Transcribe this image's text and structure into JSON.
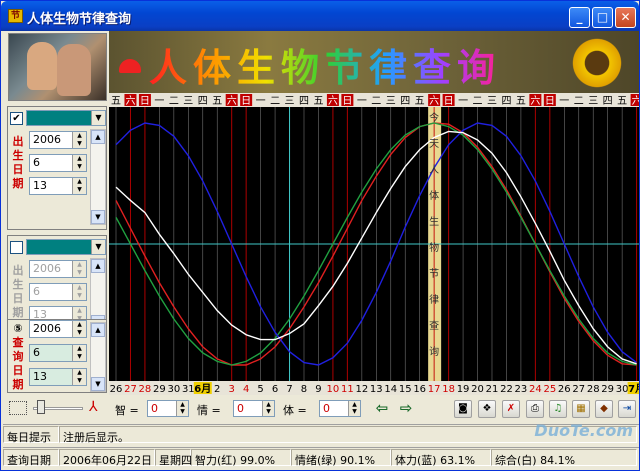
{
  "window": {
    "title": "人体生物节律查询",
    "app_icon": "节"
  },
  "banner": {
    "title": "人体生物节律查询"
  },
  "weekday_header": [
    "五",
    "六",
    "日",
    "一",
    "二",
    "三",
    "四",
    "五",
    "六",
    "日",
    "一",
    "二",
    "三",
    "四",
    "五",
    "六",
    "日",
    "一",
    "二",
    "三",
    "四",
    "五",
    "六",
    "日",
    "一",
    "二",
    "三",
    "四",
    "五",
    "六",
    "日",
    "一",
    "二",
    "三",
    "四",
    "五",
    "六",
    "日"
  ],
  "date_footer": [
    "26",
    "27",
    "28",
    "29",
    "30",
    "31",
    "6月",
    "2",
    "3",
    "4",
    "5",
    "6",
    "7",
    "8",
    "9",
    "10",
    "11",
    "12",
    "13",
    "14",
    "15",
    "16",
    "17",
    "18",
    "19",
    "20",
    "21",
    "22",
    "23",
    "24",
    "25",
    "26",
    "27",
    "28",
    "29",
    "30",
    "7月"
  ],
  "highlight_text": "今天人体生物节律查询",
  "person1": {
    "checked": true,
    "check_mark": "✔",
    "label": "出生日期",
    "year": "2006",
    "month": "6",
    "day": "13",
    "color": "#008080"
  },
  "person2": {
    "checked": false,
    "check_mark": "",
    "label": "出生日期",
    "year": "2006",
    "month": "6",
    "day": "13",
    "color": "#008080"
  },
  "query": {
    "label": "查询日期",
    "year": "2006",
    "month": "6",
    "day": "13"
  },
  "toolbar": {
    "zhi_label": "智 =",
    "zhi_value": "0",
    "qing_label": "情 =",
    "qing_value": "0",
    "ti_label": "体 =",
    "ti_value": "0",
    "left_arrow": "⇦",
    "right_arrow": "⇨"
  },
  "status": {
    "tip_label": "每日提示",
    "tip_text": "注册后显示。",
    "query_label": "查询日期",
    "query_date": "2006年06月22日",
    "weekday": "星期四",
    "zhili": "智力(红) 99.0%",
    "qingxu": "情绪(绿) 90.1%",
    "tili": "体力(蓝) 63.1%",
    "zonghe": "综合(白) 84.1%"
  },
  "watermark": "DuoTe.com",
  "colors": {
    "intellect": "#e02020",
    "emotion": "#20a040",
    "physical": "#2020e0",
    "overall": "#ffffff",
    "grid_red": "#c00000",
    "grid_white": "#d0d0d0",
    "highlight": "#e8d890"
  },
  "chart_data": {
    "type": "line",
    "title": "",
    "series": [
      {
        "name": "智力(红)",
        "values": [
          0.36,
          0.13,
          -0.1,
          -0.32,
          -0.52,
          -0.7,
          -0.85,
          -0.95,
          -1.0,
          -1.0,
          -0.95,
          -0.85,
          -0.7,
          -0.52,
          -0.32,
          -0.1,
          0.13,
          0.36,
          0.56,
          0.74,
          0.88,
          0.97,
          1.0,
          0.99,
          0.92,
          0.8,
          0.64,
          0.45,
          0.23,
          0.0,
          -0.23,
          -0.45,
          -0.64,
          -0.8,
          -0.92,
          -0.99,
          -1.0
        ]
      },
      {
        "name": "情绪(绿)",
        "values": [
          0.22,
          0.0,
          -0.22,
          -0.43,
          -0.62,
          -0.78,
          -0.9,
          -0.97,
          -1.0,
          -0.97,
          -0.9,
          -0.78,
          -0.62,
          -0.43,
          -0.22,
          0.0,
          0.22,
          0.43,
          0.62,
          0.78,
          0.9,
          0.97,
          1.0,
          0.97,
          0.9,
          0.78,
          0.62,
          0.43,
          0.22,
          0.0,
          -0.22,
          -0.43,
          -0.62,
          -0.78,
          -0.9,
          -0.97,
          -1.0
        ]
      },
      {
        "name": "体力(蓝)",
        "values": [
          0.82,
          0.94,
          1.0,
          0.98,
          0.89,
          0.73,
          0.52,
          0.27,
          0.0,
          -0.27,
          -0.52,
          -0.73,
          -0.89,
          -0.98,
          -1.0,
          -0.94,
          -0.82,
          -0.63,
          -0.4,
          -0.14,
          0.14,
          0.4,
          0.63,
          0.82,
          0.94,
          1.0,
          0.98,
          0.89,
          0.73,
          0.52,
          0.27,
          0.0,
          -0.27,
          -0.52,
          -0.73,
          -0.89,
          -0.98
        ]
      },
      {
        "name": "综合(白)",
        "values": [
          0.47,
          0.36,
          0.26,
          0.08,
          -0.08,
          -0.25,
          -0.4,
          -0.55,
          -0.67,
          -0.75,
          -0.79,
          -0.79,
          -0.74,
          -0.66,
          -0.51,
          -0.35,
          -0.16,
          0.05,
          0.26,
          0.46,
          0.64,
          0.78,
          0.88,
          0.93,
          0.92,
          0.86,
          0.75,
          0.59,
          0.39,
          0.17,
          -0.06,
          -0.3,
          -0.51,
          -0.7,
          -0.85,
          -0.95,
          -0.99
        ]
      }
    ],
    "ylim": [
      -1,
      1
    ]
  }
}
